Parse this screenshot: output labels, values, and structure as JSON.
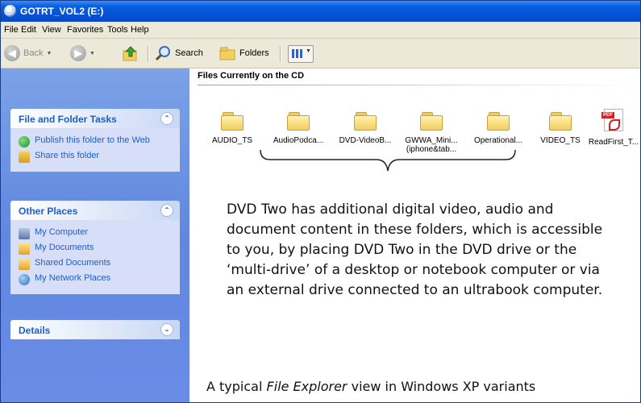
{
  "window": {
    "title": "GOTRT_VOL2 (E:)"
  },
  "menu": [
    "File",
    "Edit",
    "View",
    "Favorites",
    "Tools",
    "Help"
  ],
  "toolbar": {
    "back": "Back",
    "search": "Search",
    "folders": "Folders"
  },
  "left_panel": {
    "file_folder_tasks": {
      "title": "File and Folder Tasks",
      "items": [
        "Publish this folder to the Web",
        "Share this folder"
      ]
    },
    "other_places": {
      "title": "Other Places",
      "items": [
        "My Computer",
        "My Documents",
        "Shared Documents",
        "My Network Places"
      ]
    },
    "details": {
      "title": "Details"
    }
  },
  "content": {
    "caption": "Files Currently on the CD",
    "files": [
      {
        "name": "AUDIO_TS",
        "type": "folder"
      },
      {
        "name": "AudioPodca...",
        "type": "folder"
      },
      {
        "name": "DVD-VideoB...",
        "type": "folder"
      },
      {
        "name": "GWWA_Mini... (iphone&tab...",
        "type": "folder"
      },
      {
        "name": "Operational...",
        "type": "folder"
      },
      {
        "name": "VIDEO_TS",
        "type": "folder"
      },
      {
        "name": "ReadFirst_T...",
        "type": "pdf"
      }
    ]
  },
  "annotation": {
    "description": "DVD Two has additional digital video, audio and document content in these folders, which is accessible to you, by placing DVD Two in the DVD drive or the ‘multi-drive’ of a desktop or notebook computer or via an external drive connected to an ultrabook computer.",
    "footer_prefix": "A typical ",
    "footer_italic": "File Explorer",
    "footer_suffix": " view in Windows XP variants"
  },
  "colors": {
    "titlebar": "#0450d6",
    "left_panel": "#6a8ce6",
    "link": "#215dc6"
  }
}
